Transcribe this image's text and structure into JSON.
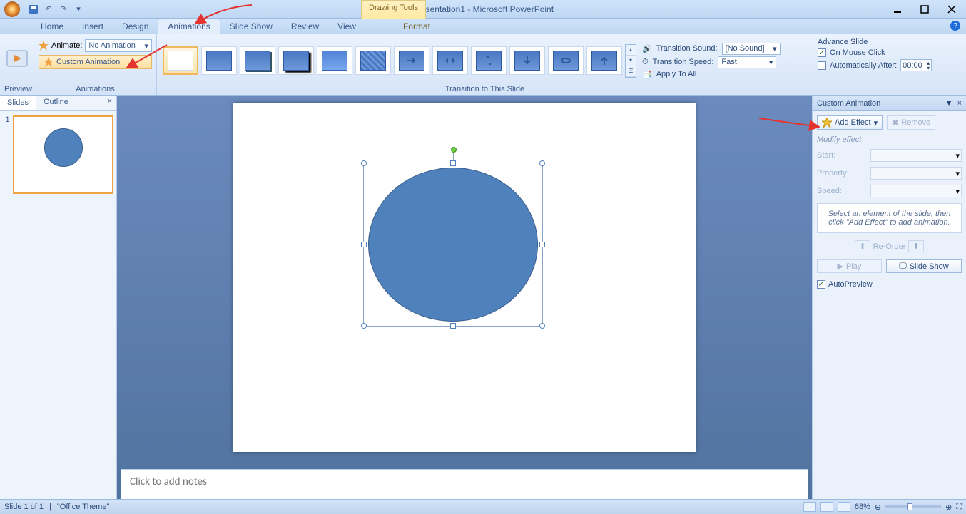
{
  "titlebar": {
    "title": "Presentation1 - Microsoft PowerPoint",
    "context": "Drawing Tools"
  },
  "ribbontabs": {
    "home": "Home",
    "insert": "Insert",
    "design": "Design",
    "animations": "Animations",
    "slideshow": "Slide Show",
    "review": "Review",
    "view": "View",
    "format": "Format"
  },
  "ribbon": {
    "preview": {
      "label": "Preview",
      "btn": "Preview"
    },
    "animations": {
      "label": "Animations",
      "animate_lbl": "Animate:",
      "animate_val": "No Animation",
      "custom_btn": "Custom Animation"
    },
    "transition": {
      "label": "Transition to This Slide",
      "sound_lbl": "Transition Sound:",
      "sound_val": "[No Sound]",
      "speed_lbl": "Transition Speed:",
      "speed_val": "Fast",
      "apply": "Apply To All"
    },
    "advance": {
      "title": "Advance Slide",
      "onclick": "On Mouse Click",
      "autoafter": "Automatically After:",
      "time": "00:00"
    }
  },
  "leftpane": {
    "tab_slides": "Slides",
    "tab_outline": "Outline",
    "slide_num": "1"
  },
  "notes_placeholder": "Click to add notes",
  "taskpane": {
    "title": "Custom Animation",
    "add_effect": "Add Effect",
    "remove": "Remove",
    "modify": "Modify effect",
    "start": "Start:",
    "property": "Property:",
    "speed": "Speed:",
    "hint": "Select an element of the slide, then click \"Add Effect\" to add animation.",
    "reorder": "Re-Order",
    "play": "Play",
    "slideshow": "Slide Show",
    "autoprev": "AutoPreview"
  },
  "status": {
    "slide": "Slide 1 of 1",
    "theme": "\"Office Theme\"",
    "zoom": "68%"
  }
}
